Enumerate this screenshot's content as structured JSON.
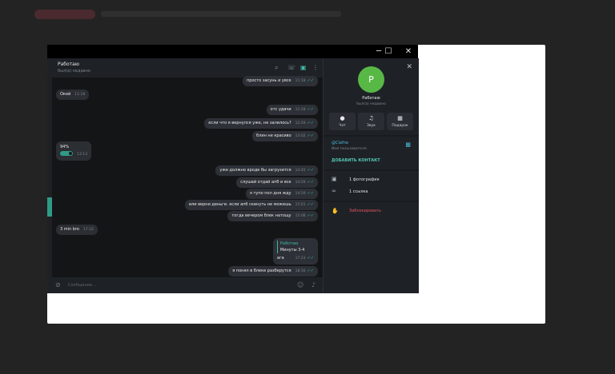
{
  "window": {
    "minimize": "─",
    "maximize": "☐",
    "close": "✕"
  },
  "chat": {
    "title": "Работаю",
    "status": "был(а) недавно",
    "input_placeholder": "Сообщение...",
    "messages": [
      {
        "text": "просто засунь и увсе",
        "time": "11:18",
        "dir": "out"
      },
      {
        "text": "Окей",
        "time": "11:18",
        "dir": "in"
      },
      {
        "text": "отс удачи",
        "time": "11:18",
        "dir": "out"
      },
      {
        "text": "если что я вернулся уже, не залилось?",
        "time": "12:29",
        "dir": "out"
      },
      {
        "text": "блин не красиво",
        "time": "13:02",
        "dir": "out"
      },
      {
        "text": "94%",
        "time": "13:13",
        "dir": "in"
      },
      {
        "text": "уже должно вроде бы загрузится",
        "time": "14:45",
        "dir": "out"
      },
      {
        "text": "слушай отдай апб и все",
        "time": "14:59",
        "dir": "out"
      },
      {
        "text": "я тупо пол дня жду",
        "time": "14:59",
        "dir": "out"
      },
      {
        "text": "или верни деньги. если апб скинуть не можешь",
        "time": "15:01",
        "dir": "out"
      },
      {
        "text": "тогда вечером блек натощу",
        "time": "15:08",
        "dir": "out"
      },
      {
        "text": "3 min bro",
        "time": "17:22",
        "dir": "in"
      },
      {
        "text": "ага",
        "time": "17:23",
        "dir": "out",
        "reply_name": "Работаю",
        "reply_text": "Минуты 3-4"
      },
      {
        "text": "я понял в блеке разберутся",
        "time": "18:16",
        "dir": "out"
      }
    ]
  },
  "profile": {
    "avatar_letter": "Р",
    "name": "Работаю",
    "status": "был(а) недавно",
    "actions": [
      {
        "label": "Чат",
        "icon": "chat-icon"
      },
      {
        "label": "Звук",
        "icon": "bell-icon"
      },
      {
        "label": "Подарок",
        "icon": "gift-icon"
      }
    ],
    "username": "@Clafne",
    "username_label": "Имя пользователя",
    "add_contact": "ДОБАВИТЬ КОНТАКТ",
    "photos": "1 фотография",
    "links": "1 ссылка",
    "block": "Заблокировать"
  },
  "colors": {
    "accent": "#42b6a3",
    "avatar": "#58b846",
    "danger": "#e0545d"
  }
}
